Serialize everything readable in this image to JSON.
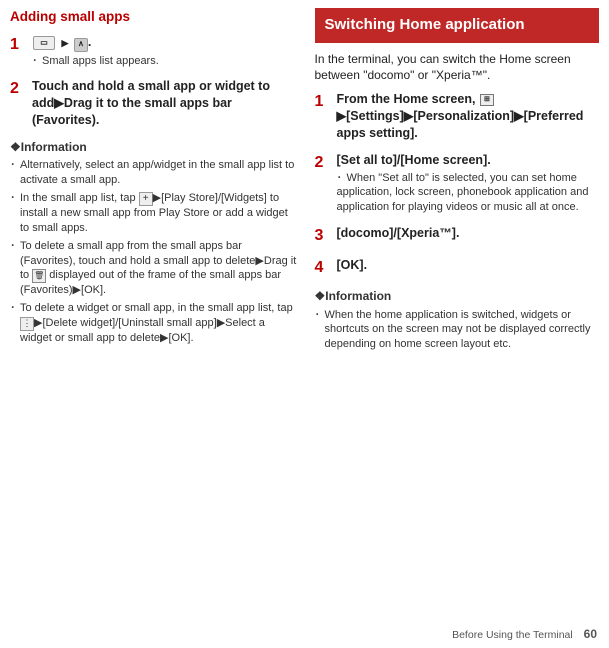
{
  "left": {
    "title": "Adding small apps",
    "step1": {
      "num": "1",
      "suffix": ".",
      "sub": "Small apps list appears."
    },
    "step2": {
      "num": "2",
      "text": "Touch and hold a small app or widget to add▶Drag it to the small apps bar (Favorites)."
    },
    "infoTitle": "❖Information",
    "bullets": {
      "b1": "Alternatively, select an app/widget in the small app list to activate a small app.",
      "b2a": "In the small app list, tap ",
      "b2b": "▶[Play Store]/[Widgets] to install a new small app from Play Store or add a widget to small apps.",
      "b3a": "To delete a small app from the small apps bar (Favorites), touch and hold a small app to delete▶Drag it to ",
      "b3b": " displayed out of the frame of the small apps bar (Favorites)▶[OK].",
      "b4a": "To delete a widget or small app, in the small app list, tap ",
      "b4b": "▶[Delete widget]/[Uninstall small app]▶Select a widget or small app to delete▶[OK]."
    }
  },
  "right": {
    "boxTitle": "Switching Home application",
    "intro": "In the terminal, you can switch the Home screen between \"docomo\" or \"Xperia™\".",
    "step1": {
      "num": "1",
      "a": "From the Home screen, ",
      "b": "▶[Settings]▶[Personalization]▶[Preferred apps setting]."
    },
    "step2": {
      "num": "2",
      "a": "[Set all to]/[Home screen].",
      "sub": "When \"Set all to\" is selected, you can set home application, lock screen, phonebook application and application for playing videos or music all at once."
    },
    "step3": {
      "num": "3",
      "a": "[docomo]/[Xperia™]."
    },
    "step4": {
      "num": "4",
      "a": "[OK]."
    },
    "infoTitle": "❖Information",
    "bullet1": "When the home application is switched, widgets or shortcuts on the screen may not be displayed correctly depending on home screen layout etc."
  },
  "footer": {
    "text": "Before Using the Terminal",
    "page": "60"
  }
}
